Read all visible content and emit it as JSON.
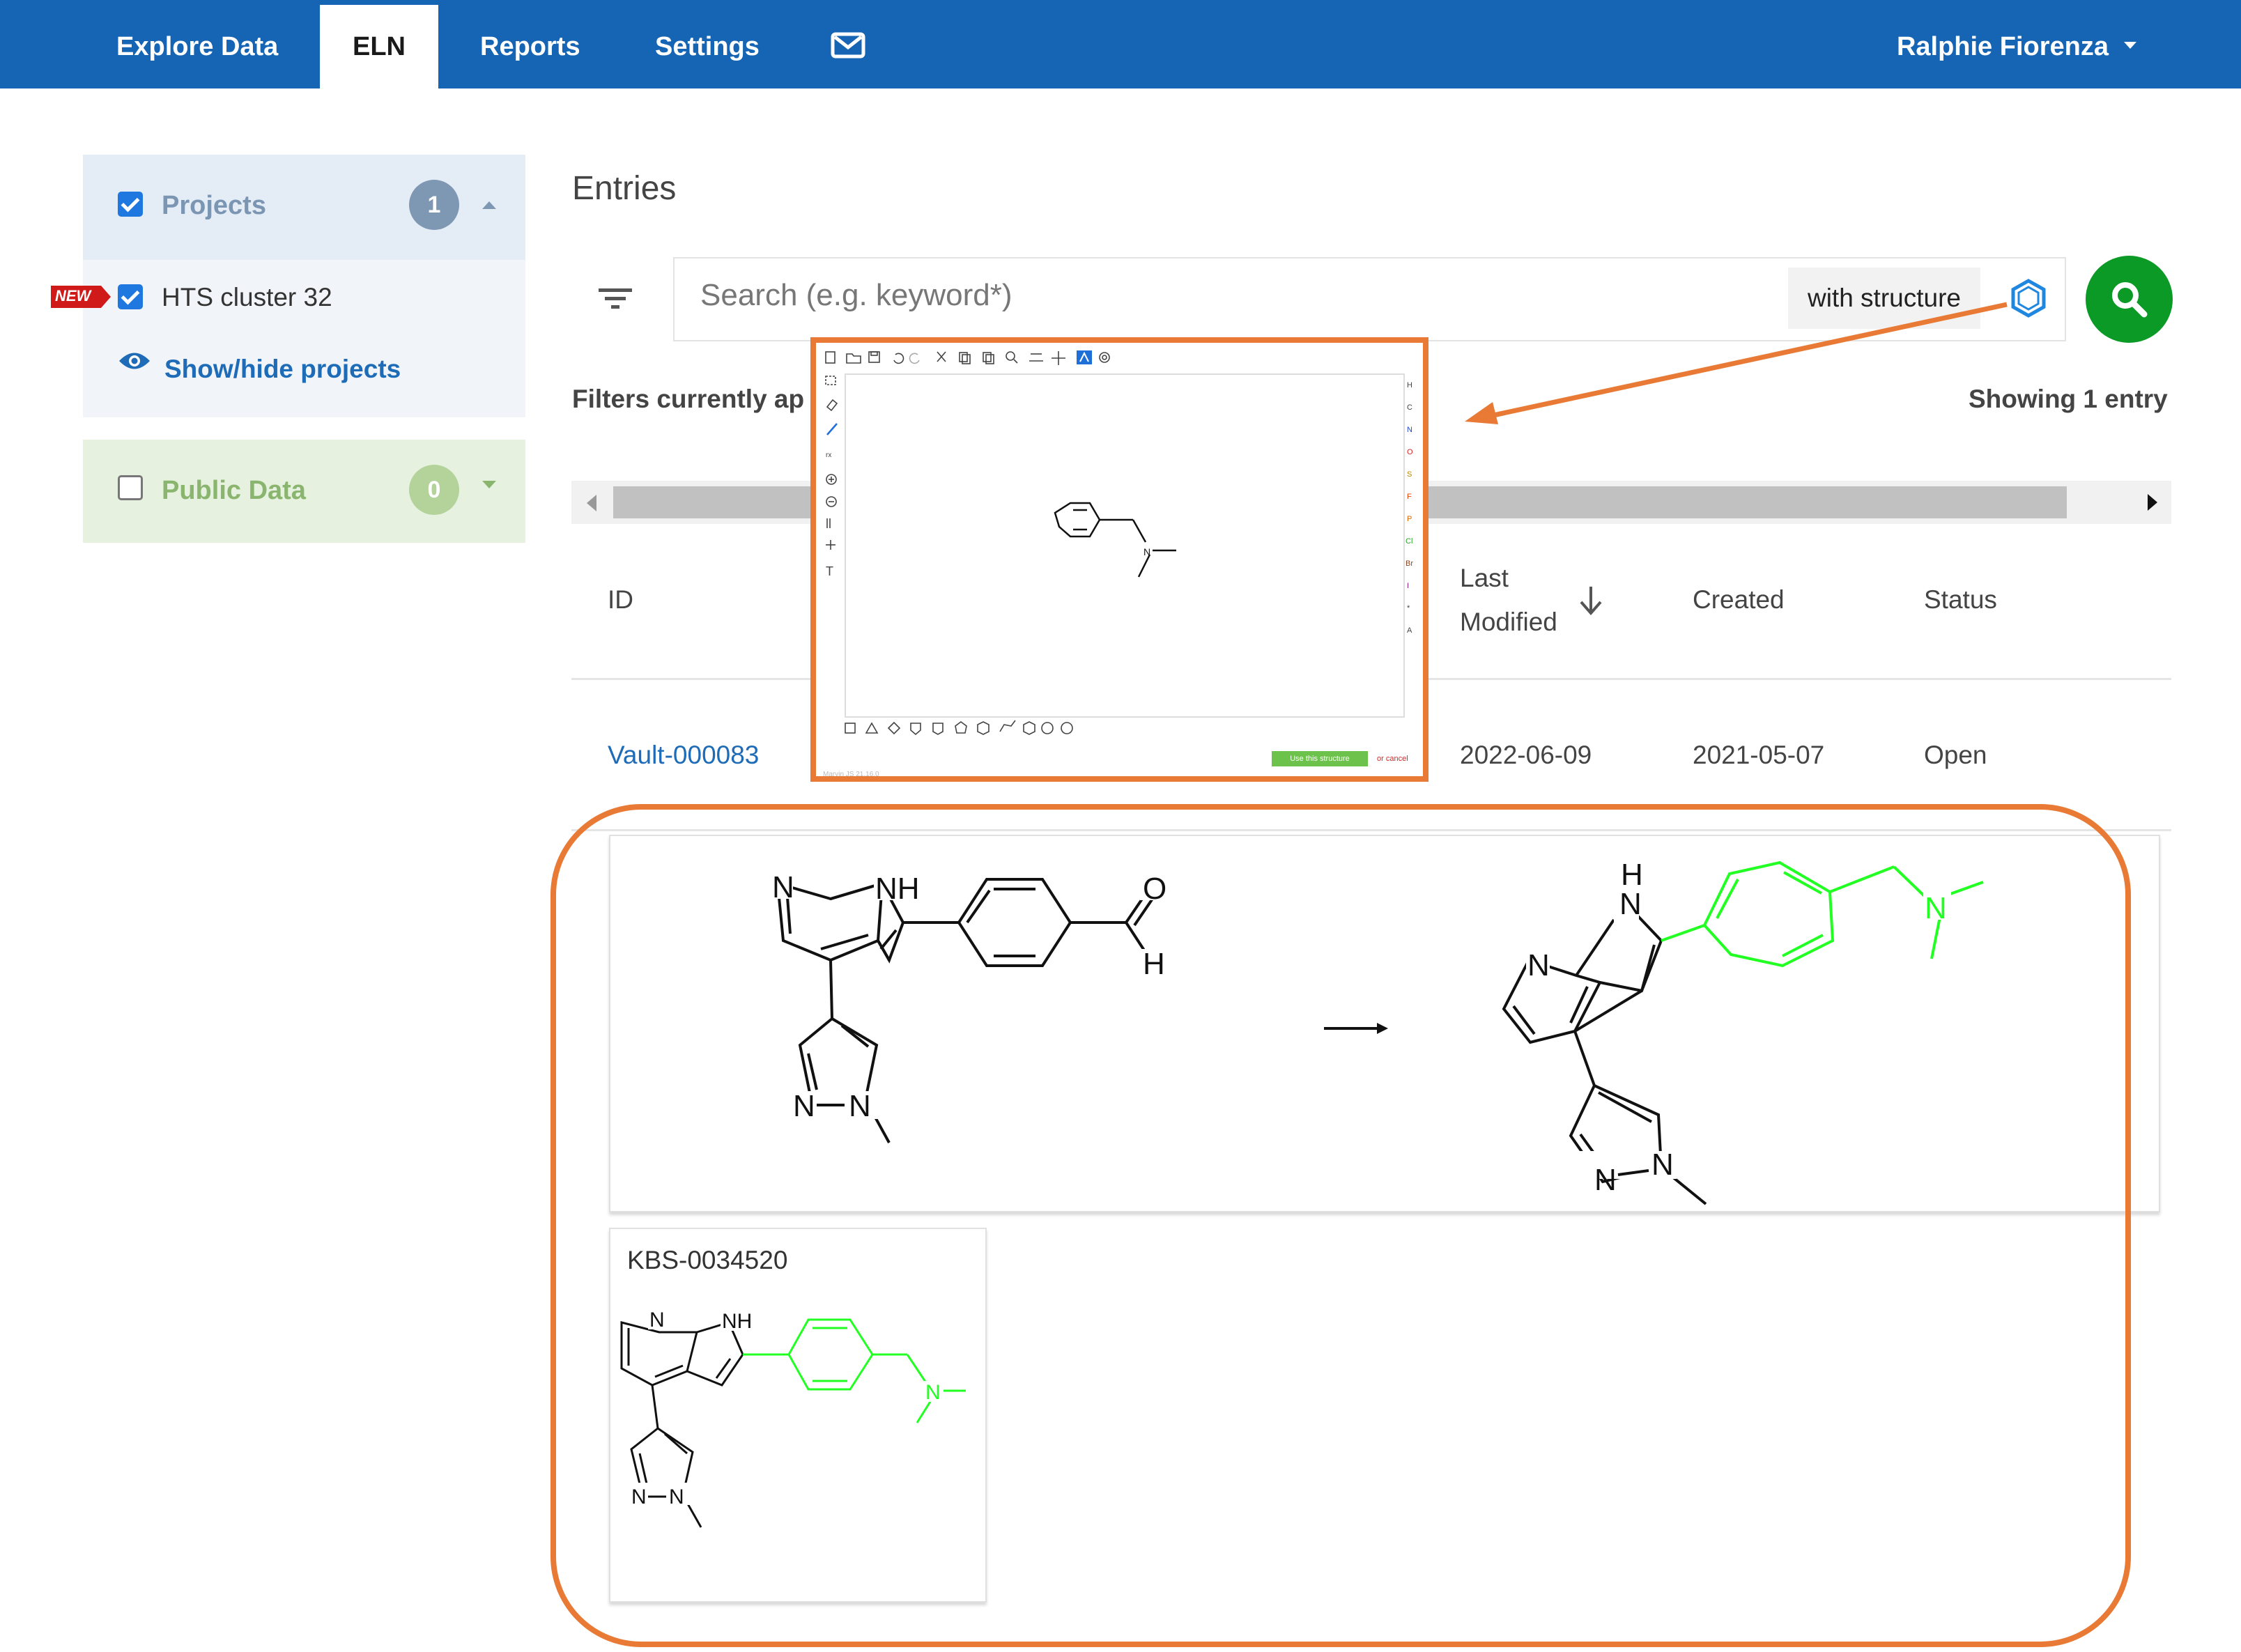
{
  "nav": {
    "items": [
      {
        "label": "Explore Data",
        "active": false
      },
      {
        "label": "ELN",
        "active": true
      },
      {
        "label": "Reports",
        "active": false
      },
      {
        "label": "Settings",
        "active": false
      }
    ],
    "mail_icon": "envelope-icon",
    "user": "Ralphie Fiorenza"
  },
  "sidebar": {
    "projects": {
      "label": "Projects",
      "count": "1",
      "checked": true
    },
    "project_items": [
      {
        "label": "HTS cluster 32",
        "badge": "NEW",
        "checked": true
      }
    ],
    "show_hide": "Show/hide projects",
    "public_data": {
      "label": "Public Data",
      "count": "0",
      "checked": false
    }
  },
  "main": {
    "title": "Entries",
    "search_placeholder": "Search (e.g. keyword*)",
    "with_structure": "with structure",
    "filters_text": "Filters currently ap",
    "showing": "Showing 1 entry",
    "columns": {
      "id": "ID",
      "last_modified_1": "Last",
      "last_modified_2": "Modified",
      "created": "Created",
      "status": "Status"
    },
    "row": {
      "id": "Vault-000083",
      "last_modified": "2022-06-09",
      "created": "2021-05-07",
      "status": "Open"
    },
    "compound_card": {
      "name": "KBS-0034520"
    }
  },
  "editor": {
    "use_button": "Use this structure",
    "cancel": "or cancel",
    "version": "Marvin JS 21.16.0",
    "elements": [
      "H",
      "C",
      "N",
      "O",
      "S",
      "F",
      "P",
      "Cl",
      "Br",
      "I"
    ]
  },
  "colors": {
    "navbar": "#1565b4",
    "highlight_green": "#00e000",
    "annotation_orange": "#e87a35",
    "search_green": "#0a9a25",
    "link_blue": "#1e6bb8"
  }
}
